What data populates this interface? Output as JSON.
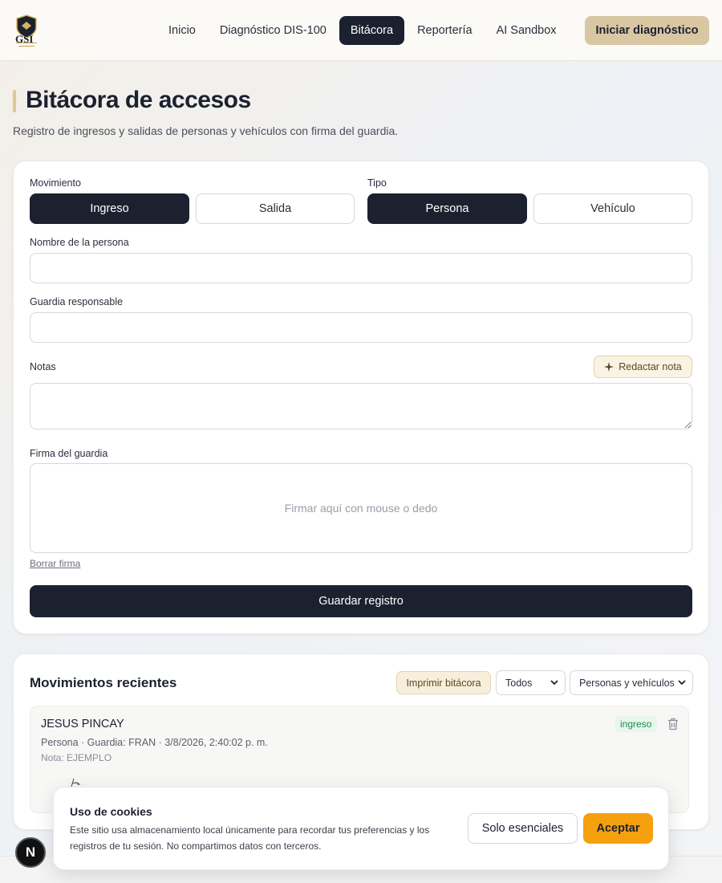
{
  "header": {
    "logo_text": "GSI",
    "nav": [
      "Inicio",
      "Diagnóstico DIS-100",
      "Bitácora",
      "Reportería",
      "AI Sandbox"
    ],
    "active_nav": "Bitácora",
    "cta_label": "Iniciar diagnóstico"
  },
  "page": {
    "title": "Bitácora de accesos",
    "subtitle": "Registro de ingresos y salidas de personas y vehículos con firma del guardia."
  },
  "form": {
    "movement_label": "Movimiento",
    "movement_options": [
      "Ingreso",
      "Salida"
    ],
    "movement_selected": "Ingreso",
    "type_label": "Tipo",
    "type_options": [
      "Persona",
      "Vehículo"
    ],
    "type_selected": "Persona",
    "person_label": "Nombre de la persona",
    "person_value": "",
    "guard_label": "Guardia responsable",
    "guard_value": "",
    "notes_label": "Notas",
    "notes_value": "",
    "ai_note_label": "Redactar nota",
    "signature_label": "Firma del guardia",
    "signature_placeholder": "Firmar aquí con mouse o dedo",
    "clear_signature": "Borrar firma",
    "save_label": "Guardar registro"
  },
  "recent": {
    "title": "Movimientos recientes",
    "print_label": "Imprimir bitácora",
    "filter_movement": "Todos",
    "filter_type": "Personas y vehículos",
    "entries": [
      {
        "name": "JESUS PINCAY",
        "meta": "Persona · Guardia: FRAN · 3/8/2026, 2:40:02 p. m.",
        "note": "Nota: EJEMPLO",
        "badge": "ingreso"
      }
    ]
  },
  "cookie": {
    "title": "Uso de cookies",
    "text": "Este sitio usa almacenamiento local únicamente para recordar tus preferencias y los registros de tu sesión. No compartimos datos con terceros.",
    "essentials_label": "Solo esenciales",
    "accept_label": "Aceptar"
  },
  "floating_badge": "N",
  "colors": {
    "primary": "#1c2130",
    "accent": "#d9c7a3",
    "accept": "#f5a00f",
    "badge_green": "#1e8a4c"
  }
}
